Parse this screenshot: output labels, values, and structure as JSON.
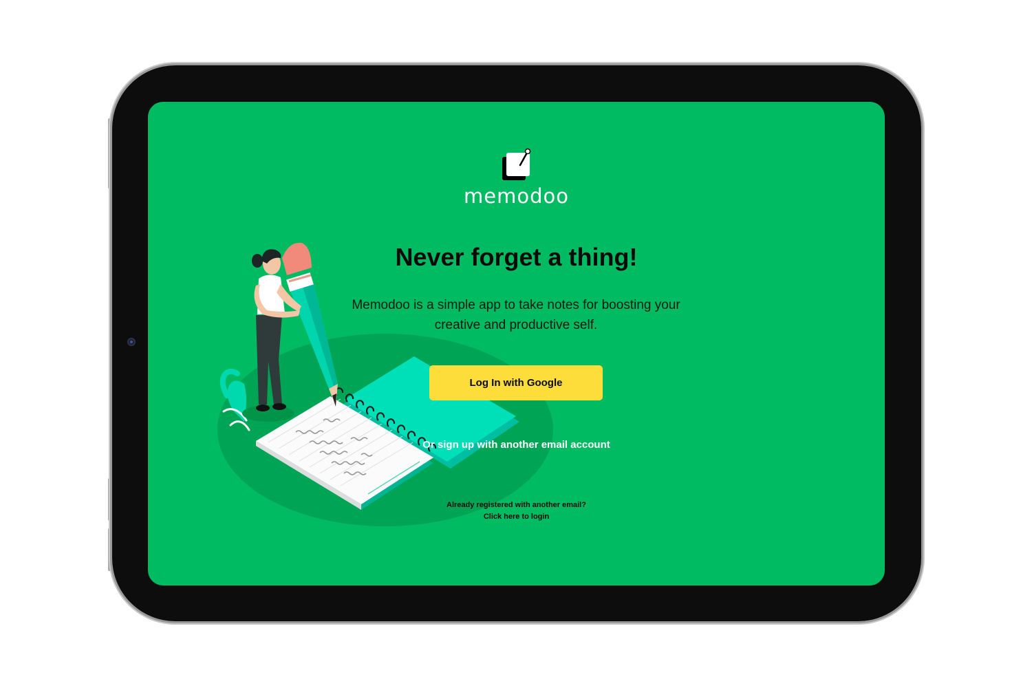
{
  "app": {
    "name": "memodoo",
    "logo_icon": "note-pin-icon"
  },
  "hero": {
    "headline": "Never forget a thing!",
    "tagline": "Memodoo is a simple app to take notes for boosting your creative and productive self.",
    "illustration": "woman-writing-in-notebook-illustration"
  },
  "auth": {
    "google_label": "Log In with Google",
    "signup_label": "Or sign up with another email account",
    "already_registered": "Already registered with another email?",
    "login_link": "Click here to login"
  },
  "colors": {
    "screen_bg": "#00bb62",
    "button_bg": "#fcdd3a",
    "device": "#0d0d0d",
    "accent_teal": "#00e0b8"
  }
}
